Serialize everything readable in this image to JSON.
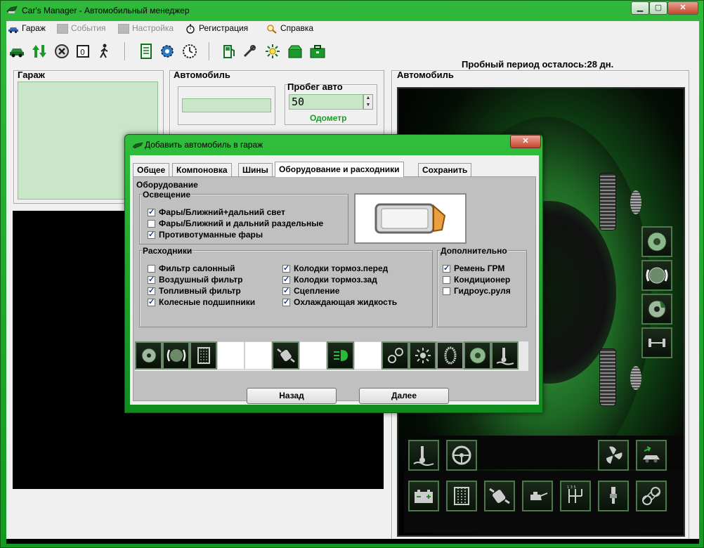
{
  "window": {
    "title": "Car's Manager - Автомобильный менеджер"
  },
  "menu": [
    {
      "label": "Гараж",
      "icon": "car-icon",
      "enabled": true
    },
    {
      "label": "События",
      "icon": "gray-square-icon",
      "enabled": false
    },
    {
      "label": "Настройка",
      "icon": "gray-square-icon",
      "enabled": false
    },
    {
      "label": "Регистрация",
      "icon": "stopwatch-icon",
      "enabled": true
    },
    {
      "label": "Справка",
      "icon": "magnifier-icon",
      "enabled": true
    }
  ],
  "trial": "Пробный период осталось:28 дн.",
  "garage": {
    "title": "Гараж"
  },
  "auto": {
    "title": "Автомобиль",
    "mileage_label": "Пробег авто",
    "mileage_value": "50",
    "odometer": "Одометр"
  },
  "car_panel": {
    "title": "Автомобиль"
  },
  "dialog": {
    "title": "Добавить автомобиль в гараж",
    "tabs": [
      "Общее",
      "Компоновка",
      "Шины",
      "Оборудование и расходники",
      "Сохранить"
    ],
    "active_tab": 3,
    "equipment_label": "Оборудование",
    "lighting": {
      "label": "Освещение",
      "items": [
        {
          "label": "Фары/Ближний+дальний свет",
          "checked": true
        },
        {
          "label": "Фары/Ближний и дальний раздельные",
          "checked": false
        },
        {
          "label": "Противотуманные фары",
          "checked": true
        }
      ]
    },
    "consumables": {
      "label": "Расходники",
      "col1": [
        {
          "label": "Фильтр салонный",
          "checked": false
        },
        {
          "label": "Воздушный фильтр",
          "checked": true
        },
        {
          "label": "Топливный фильтр",
          "checked": true
        },
        {
          "label": "Колесные подшипники",
          "checked": true
        }
      ],
      "col2": [
        {
          "label": "Колодки тормоз.перед",
          "checked": true
        },
        {
          "label": "Колодки тормоз.зад",
          "checked": true
        },
        {
          "label": "Сцепление",
          "checked": true
        },
        {
          "label": "Охлаждающая жидкость",
          "checked": true
        }
      ]
    },
    "additional": {
      "label": "Дополнительно",
      "items": [
        {
          "label": "Ремень ГРМ",
          "checked": true
        },
        {
          "label": "Кондиционер",
          "checked": false
        },
        {
          "label": "Гидроус.руля",
          "checked": false
        }
      ]
    },
    "back": "Назад",
    "next": "Далее"
  },
  "colors": {
    "window_green": "#1f9a2a",
    "panel_green": "#c9e6c9",
    "odometer_green": "#1a9a2a"
  }
}
